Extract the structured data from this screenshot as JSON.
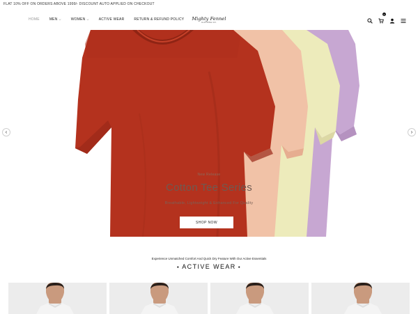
{
  "announcement": "FLAT 10% OFF ON ORDERS ABOVE 1999/- DISCOUNT AUTO APPLIED ON CHECKOUT",
  "nav": {
    "home": "HOME",
    "men": "MEN",
    "women": "WOMEN",
    "active_wear": "ACTIVE WEAR",
    "policy": "RETURN & REFUND POLICY"
  },
  "logo": {
    "main": "Mighty Fennel",
    "sub": "clothing co."
  },
  "header_icons": [
    "search-icon",
    "cart-icon",
    "user-icon",
    "menu-icon"
  ],
  "cart_count": "0",
  "hero": {
    "tag": "New Release",
    "title": "Cotton Tee Series",
    "subtitle": "Breathable, Lightweight & Enhanced For Quality",
    "button": "SHOP NOW",
    "prev": "‹",
    "next": "›"
  },
  "section": {
    "tagline": "Experience Unmatched Comfort And Quick Dry Feature With Our Active Essentials",
    "title": "ACTIVE WEAR"
  },
  "colors": {
    "shirt_red": "#b5321f",
    "shirt_peach": "#f2c3a8",
    "shirt_yellow": "#eeeaba",
    "shirt_lavender": "#c9a9d3",
    "product_bg": "#ececec"
  }
}
